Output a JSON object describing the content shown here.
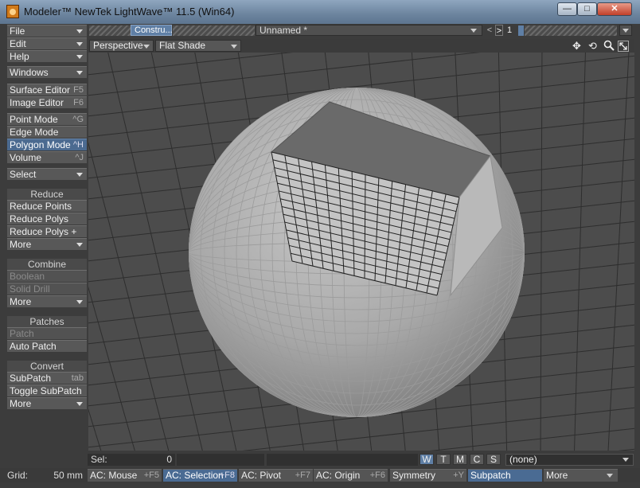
{
  "window": {
    "title": "Modeler™ NewTek LightWave™ 11.5 (Win64)",
    "buttons": {
      "minimize": "—",
      "maximize": "□",
      "close": "✕"
    }
  },
  "left_panel": {
    "file": "File",
    "edit": "Edit",
    "help": "Help",
    "windows": "Windows",
    "surface_editor": {
      "label": "Surface Editor",
      "shortcut": "F5"
    },
    "image_editor": {
      "label": "Image Editor",
      "shortcut": "F6"
    },
    "point_mode": {
      "label": "Point Mode",
      "shortcut": "^G"
    },
    "edge_mode": {
      "label": "Edge Mode",
      "shortcut": ""
    },
    "polygon_mode": {
      "label": "Polygon Mode",
      "shortcut": "^H"
    },
    "volume": {
      "label": "Volume",
      "shortcut": "^J"
    },
    "select": "Select",
    "reduce": {
      "header": "Reduce",
      "items": [
        "Reduce Points",
        "Reduce Polys",
        "Reduce Polys +"
      ],
      "more": "More"
    },
    "combine": {
      "header": "Combine",
      "items": [
        "Boolean",
        "Solid Drill"
      ],
      "more": "More"
    },
    "patches": {
      "header": "Patches",
      "items": [
        "Patch",
        "Auto Patch"
      ]
    },
    "convert": {
      "header": "Convert",
      "subpatch": {
        "label": "SubPatch",
        "shortcut": "tab"
      },
      "toggle": "Toggle SubPatch",
      "more": "More"
    }
  },
  "top_toolbar": {
    "layer_tab": "Constru...",
    "object_name": "Unnamed *",
    "layer_number": "1",
    "prev": "<",
    "next": ">"
  },
  "viewport": {
    "view_mode": "Perspective",
    "shading": "Flat Shade"
  },
  "status_bar": {
    "sel_label": "Sel:",
    "sel_count": "0",
    "modes": [
      "W",
      "T",
      "M",
      "C",
      "S"
    ],
    "dropdown": "(none)"
  },
  "bottom_bar": {
    "grid_label": "Grid:",
    "grid_value": "50 mm",
    "ac_mouse": {
      "label": "AC: Mouse",
      "key": "+F5"
    },
    "ac_selection": {
      "label": "AC: Selection",
      "key": "+F8"
    },
    "ac_pivot": {
      "label": "AC: Pivot",
      "key": "+F7"
    },
    "ac_origin": {
      "label": "AC: Origin",
      "key": "+F6"
    },
    "symmetry": {
      "label": "Symmetry",
      "key": "+Y"
    },
    "subpatch": "Subpatch",
    "more": "More"
  },
  "colors": {
    "accent_blue": "#4b6a90",
    "panel_bg": "#3c3c3c",
    "button_bg": "#585858",
    "viewport_bg": "#4c4c4c"
  }
}
